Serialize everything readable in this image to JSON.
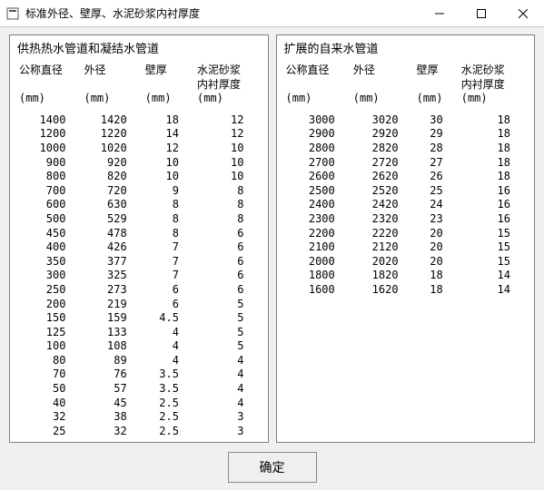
{
  "window": {
    "title": "标准外径、壁厚、水泥砂浆内衬厚度"
  },
  "left": {
    "title": "供热热水管道和凝结水管道",
    "headers": {
      "c1": "公称直径",
      "c2": "外径",
      "c3": "壁厚",
      "c4": "水泥砂浆\n内衬厚度"
    },
    "units": {
      "c1": "(mm)",
      "c2": "(mm)",
      "c3": "(mm)",
      "c4": "(mm)"
    },
    "rows": [
      {
        "dn": "1400",
        "od": "1420",
        "wt": "18",
        "lt": "12"
      },
      {
        "dn": "1200",
        "od": "1220",
        "wt": "14",
        "lt": "12"
      },
      {
        "dn": "1000",
        "od": "1020",
        "wt": "12",
        "lt": "10"
      },
      {
        "dn": "900",
        "od": "920",
        "wt": "10",
        "lt": "10"
      },
      {
        "dn": "800",
        "od": "820",
        "wt": "10",
        "lt": "10"
      },
      {
        "dn": "700",
        "od": "720",
        "wt": "9",
        "lt": "8"
      },
      {
        "dn": "600",
        "od": "630",
        "wt": "8",
        "lt": "8"
      },
      {
        "dn": "500",
        "od": "529",
        "wt": "8",
        "lt": "8"
      },
      {
        "dn": "450",
        "od": "478",
        "wt": "8",
        "lt": "6"
      },
      {
        "dn": "400",
        "od": "426",
        "wt": "7",
        "lt": "6"
      },
      {
        "dn": "350",
        "od": "377",
        "wt": "7",
        "lt": "6"
      },
      {
        "dn": "300",
        "od": "325",
        "wt": "7",
        "lt": "6"
      },
      {
        "dn": "250",
        "od": "273",
        "wt": "6",
        "lt": "6"
      },
      {
        "dn": "200",
        "od": "219",
        "wt": "6",
        "lt": "5"
      },
      {
        "dn": "150",
        "od": "159",
        "wt": "4.5",
        "lt": "5"
      },
      {
        "dn": "125",
        "od": "133",
        "wt": "4",
        "lt": "5"
      },
      {
        "dn": "100",
        "od": "108",
        "wt": "4",
        "lt": "5"
      },
      {
        "dn": "80",
        "od": "89",
        "wt": "4",
        "lt": "4"
      },
      {
        "dn": "70",
        "od": "76",
        "wt": "3.5",
        "lt": "4"
      },
      {
        "dn": "50",
        "od": "57",
        "wt": "3.5",
        "lt": "4"
      },
      {
        "dn": "40",
        "od": "45",
        "wt": "2.5",
        "lt": "4"
      },
      {
        "dn": "32",
        "od": "38",
        "wt": "2.5",
        "lt": "3"
      },
      {
        "dn": "25",
        "od": "32",
        "wt": "2.5",
        "lt": "3"
      }
    ]
  },
  "right": {
    "title": "扩展的自来水管道",
    "headers": {
      "c1": "公称直径",
      "c2": "外径",
      "c3": "壁厚",
      "c4": "水泥砂浆\n内衬厚度"
    },
    "units": {
      "c1": "(mm)",
      "c2": "(mm)",
      "c3": "(mm)",
      "c4": "(mm)"
    },
    "rows": [
      {
        "dn": "3000",
        "od": "3020",
        "wt": "30",
        "lt": "18"
      },
      {
        "dn": "2900",
        "od": "2920",
        "wt": "29",
        "lt": "18"
      },
      {
        "dn": "2800",
        "od": "2820",
        "wt": "28",
        "lt": "18"
      },
      {
        "dn": "2700",
        "od": "2720",
        "wt": "27",
        "lt": "18"
      },
      {
        "dn": "2600",
        "od": "2620",
        "wt": "26",
        "lt": "18"
      },
      {
        "dn": "2500",
        "od": "2520",
        "wt": "25",
        "lt": "16"
      },
      {
        "dn": "2400",
        "od": "2420",
        "wt": "24",
        "lt": "16"
      },
      {
        "dn": "2300",
        "od": "2320",
        "wt": "23",
        "lt": "16"
      },
      {
        "dn": "2200",
        "od": "2220",
        "wt": "20",
        "lt": "15"
      },
      {
        "dn": "2100",
        "od": "2120",
        "wt": "20",
        "lt": "15"
      },
      {
        "dn": "2000",
        "od": "2020",
        "wt": "20",
        "lt": "15"
      },
      {
        "dn": "1800",
        "od": "1820",
        "wt": "18",
        "lt": "14"
      },
      {
        "dn": "1600",
        "od": "1620",
        "wt": "18",
        "lt": "14"
      }
    ]
  },
  "buttons": {
    "ok": "确定"
  }
}
